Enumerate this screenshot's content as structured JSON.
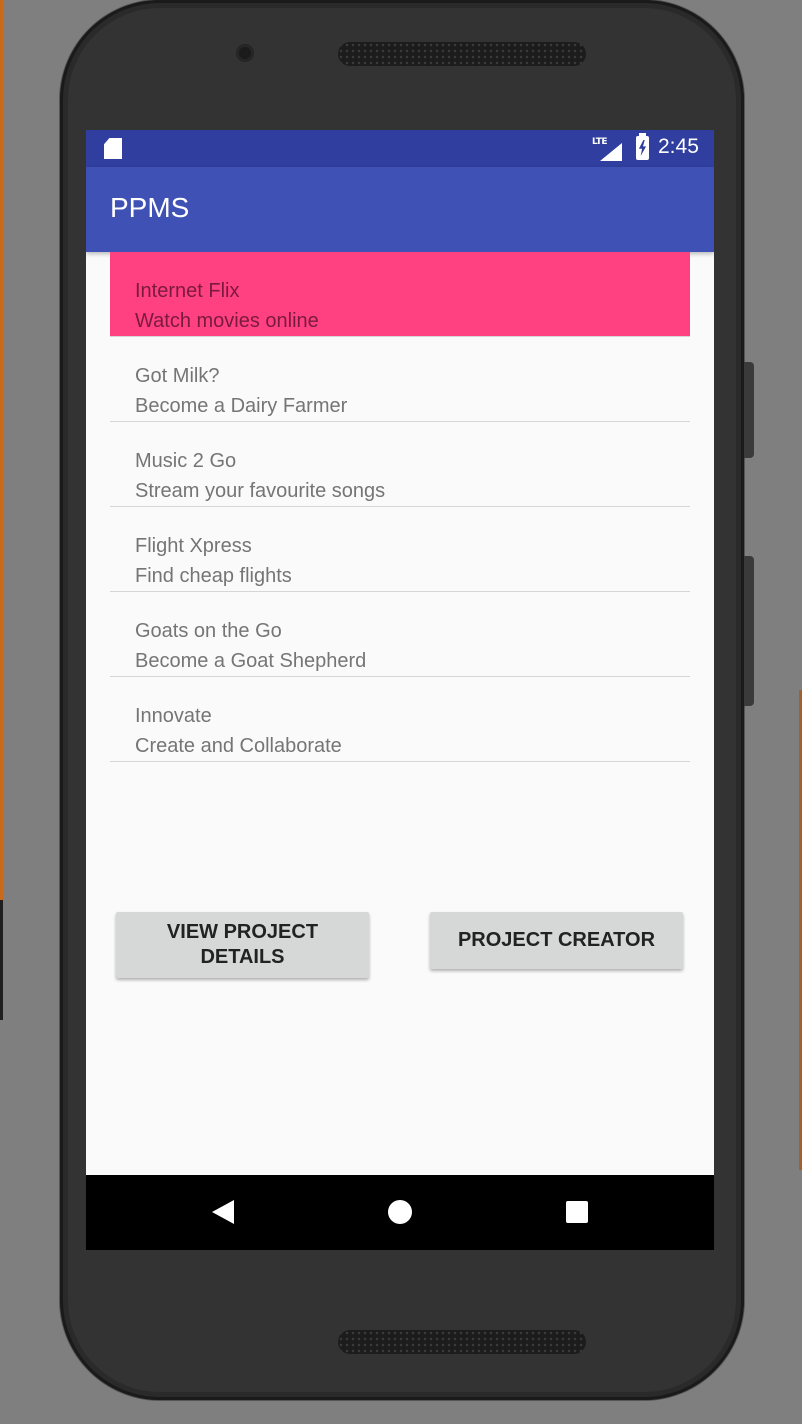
{
  "status_bar": {
    "network_label": "LTE",
    "time": "2:45",
    "icons": [
      "sd-card-icon",
      "lte-signal-icon",
      "battery-charging-icon"
    ]
  },
  "app_bar": {
    "title": "PPMS"
  },
  "projects": [
    {
      "name": "Internet Flix",
      "description": "Watch movies online",
      "selected": true
    },
    {
      "name": "Got Milk?",
      "description": "Become a Dairy Farmer",
      "selected": false
    },
    {
      "name": "Music 2 Go",
      "description": "Stream your favourite songs",
      "selected": false
    },
    {
      "name": "Flight Xpress",
      "description": "Find cheap flights",
      "selected": false
    },
    {
      "name": "Goats on the Go",
      "description": "Become a Goat Shepherd",
      "selected": false
    },
    {
      "name": "Innovate",
      "description": "Create and Collaborate",
      "selected": false
    }
  ],
  "buttons": {
    "view_details": "VIEW PROJECT DETAILS",
    "creator": "PROJECT CREATOR"
  },
  "nav_bar": {
    "icons": [
      "back-icon",
      "home-icon",
      "recent-apps-icon"
    ]
  },
  "colors": {
    "status_bar": "#303f9f",
    "app_bar": "#3f51b5",
    "selected_item": "#ff4081",
    "background": "#fafafa"
  }
}
